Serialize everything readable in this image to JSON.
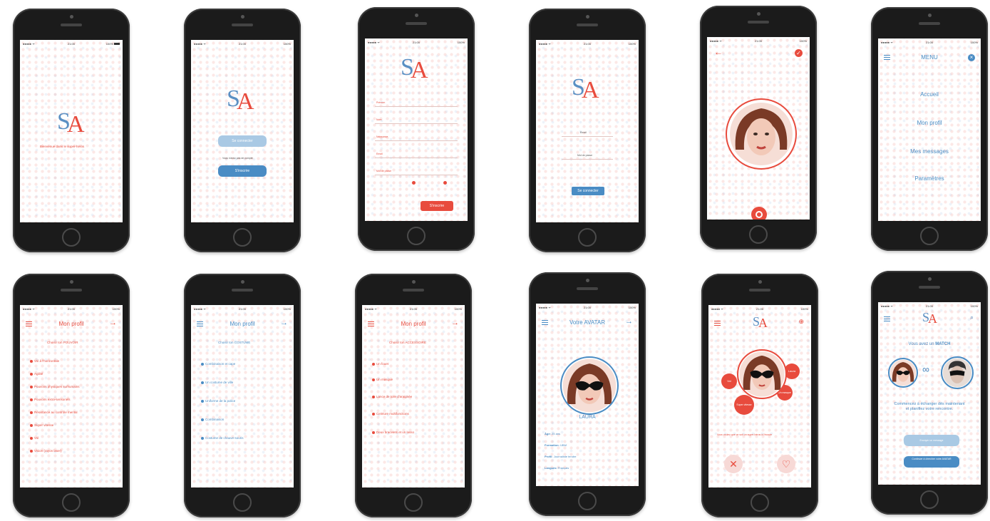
{
  "status": {
    "time": "21:00",
    "battery": "100%",
    "carrier": "●●●●● ᯤ"
  },
  "splash": {
    "tagline": "Bienvenue dans le super-héros"
  },
  "login_choice": {
    "login_btn": "Se connecter",
    "no_account": "Vous n'avez pas de compte",
    "signup_btn": "S'inscrire"
  },
  "signup": {
    "fields": [
      "Prénom",
      "Nom",
      "Naissance",
      "Email",
      "Mot de passe"
    ],
    "btn": "S'inscrire"
  },
  "login": {
    "fields": [
      "Email",
      "Mot de passe"
    ],
    "btn": "Se connecter"
  },
  "menu": {
    "title": "MENU",
    "items": [
      "Accueil",
      "Mon profil",
      "Mes messages",
      "Paramètres"
    ]
  },
  "profil_power": {
    "title": "Mon profil",
    "subtitle": "Choisir ton POUVOIR",
    "items": [
      "Vol à l'horizontale",
      "Agilité",
      "Pouvoirs physiques surhumains",
      "Pouvoirs extra-sensoriels",
      "Résistance au contrôle mental",
      "Super vitesse",
      "Vol",
      "Vision (rayon laser)"
    ]
  },
  "profil_costume": {
    "title": "Mon profil",
    "subtitle": "Choisir ton COSTUME",
    "items": [
      "Combinaison et cape",
      "Un costume de ville",
      "Uniforme de la police",
      "Combinaison",
      "Costume de chauve-souris"
    ]
  },
  "profil_accessoire": {
    "title": "Mon profil",
    "subtitle": "Choisir ton ACCESSOIRE",
    "items": [
      "Un fouet",
      "Un masque",
      "Lance de toile d'araignée",
      "Ceinture multifonctions",
      "Deux bracelets et un lasso"
    ]
  },
  "avatar": {
    "title": "Votre AVATAR",
    "name": "LAURA",
    "details": [
      {
        "label": "Âge:",
        "value": "25 ans"
      },
      {
        "label": "Formation:",
        "value": "UBM"
      },
      {
        "label": "Profil:",
        "value": "Journaliste tendre"
      },
      {
        "label": "Langues:",
        "value": "Français"
      }
    ]
  },
  "swipe": {
    "bubbles": [
      "Vol",
      "Laura",
      "Super vitesse",
      "Un masque"
    ],
    "bio": "Vous voulez que ce soit un super-héros à l'écoute"
  },
  "match": {
    "text_prefix": "Vous avez un",
    "text_bold": "MATCH",
    "body": "Commencez à échanger dès maintenant et planifiez votre rencontre.",
    "btn1": "Envoyer un message",
    "btn2": "Continuer à chercher votre AVATAR"
  },
  "colors": {
    "red": "#e84b3d",
    "blue": "#4a8cc4",
    "light_blue": "#a9c9e4"
  }
}
